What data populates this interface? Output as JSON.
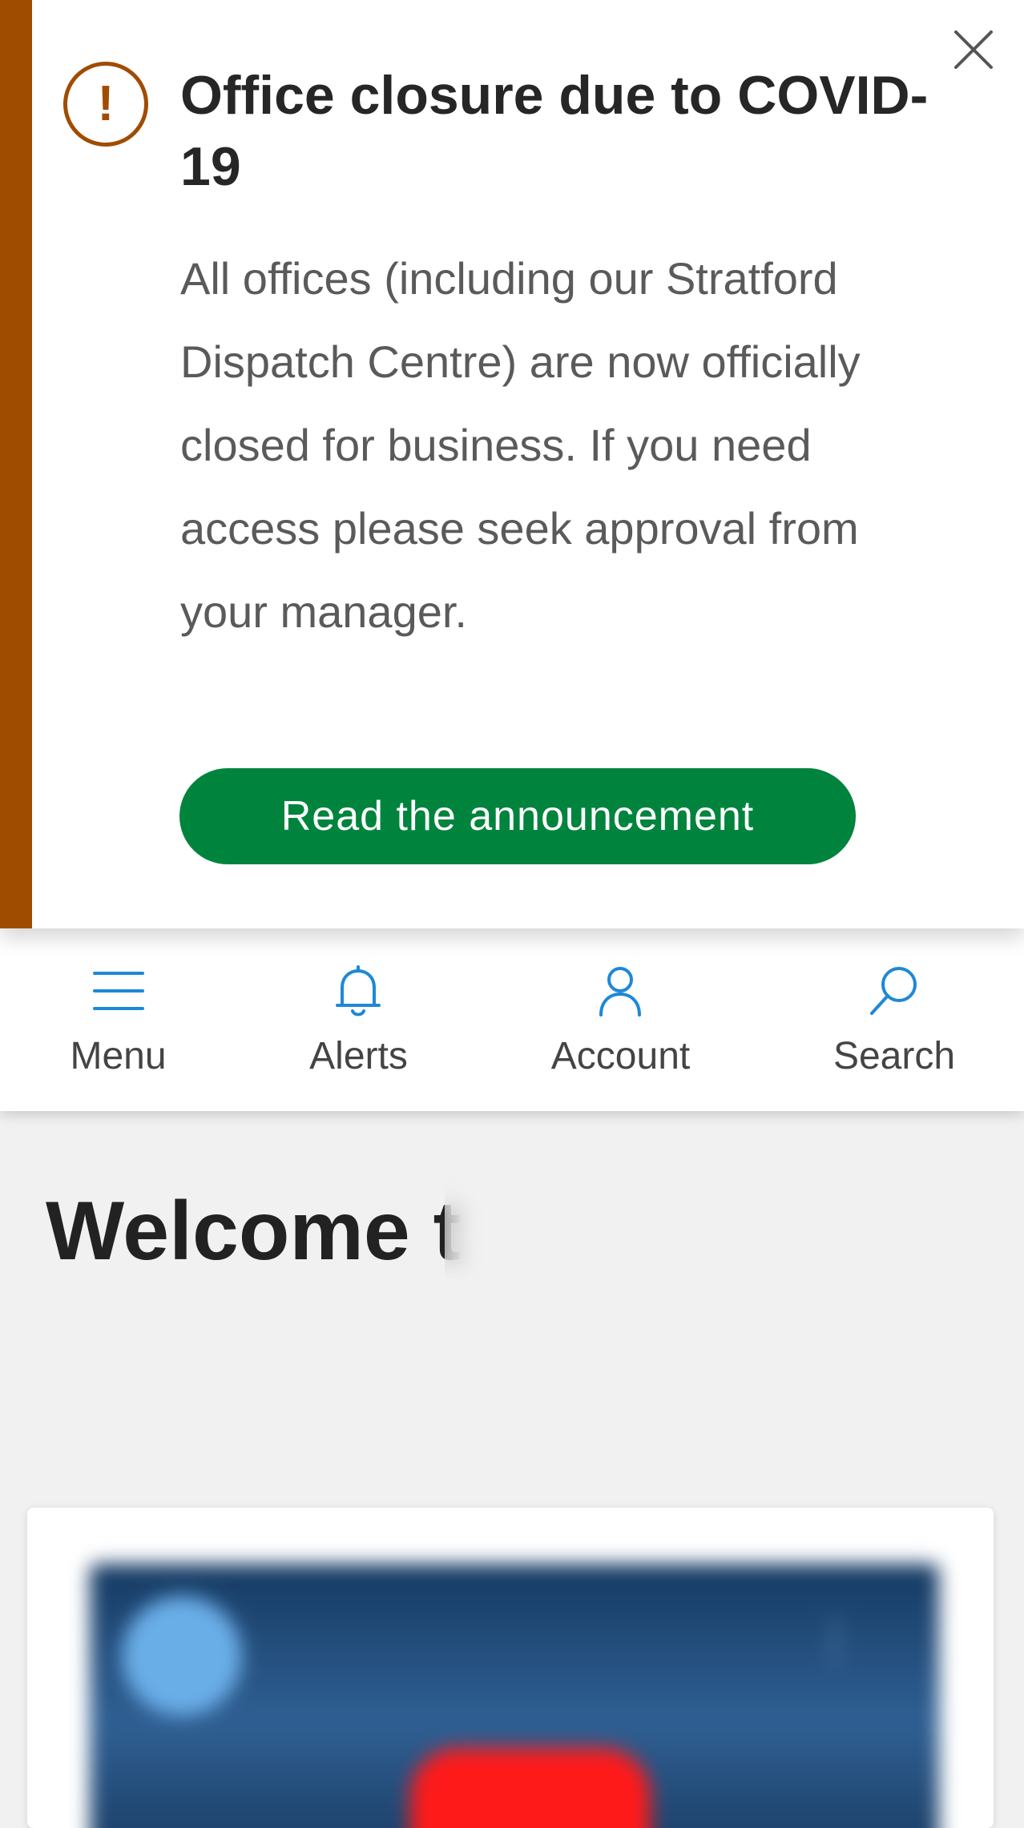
{
  "alert": {
    "title": "Office closure due to COVID-19",
    "body": "All offices (including our Stratford Dispatch Centre) are now officially closed for business. If you need access please seek approval from your manager.",
    "button_label": "Read the announcement",
    "icon_glyph": "!",
    "icon": "exclamation-circle-icon",
    "close_icon": "close-icon",
    "stripe_color": "#a04c00",
    "button_color": "#00843d"
  },
  "nav": {
    "items": [
      {
        "label": "Menu",
        "icon": "hamburger-menu-icon"
      },
      {
        "label": "Alerts",
        "icon": "bell-icon"
      },
      {
        "label": "Account",
        "icon": "user-icon"
      },
      {
        "label": "Search",
        "icon": "search-icon"
      }
    ],
    "icon_color": "#1e88d6"
  },
  "content": {
    "heading_visible": "Welcome t"
  }
}
